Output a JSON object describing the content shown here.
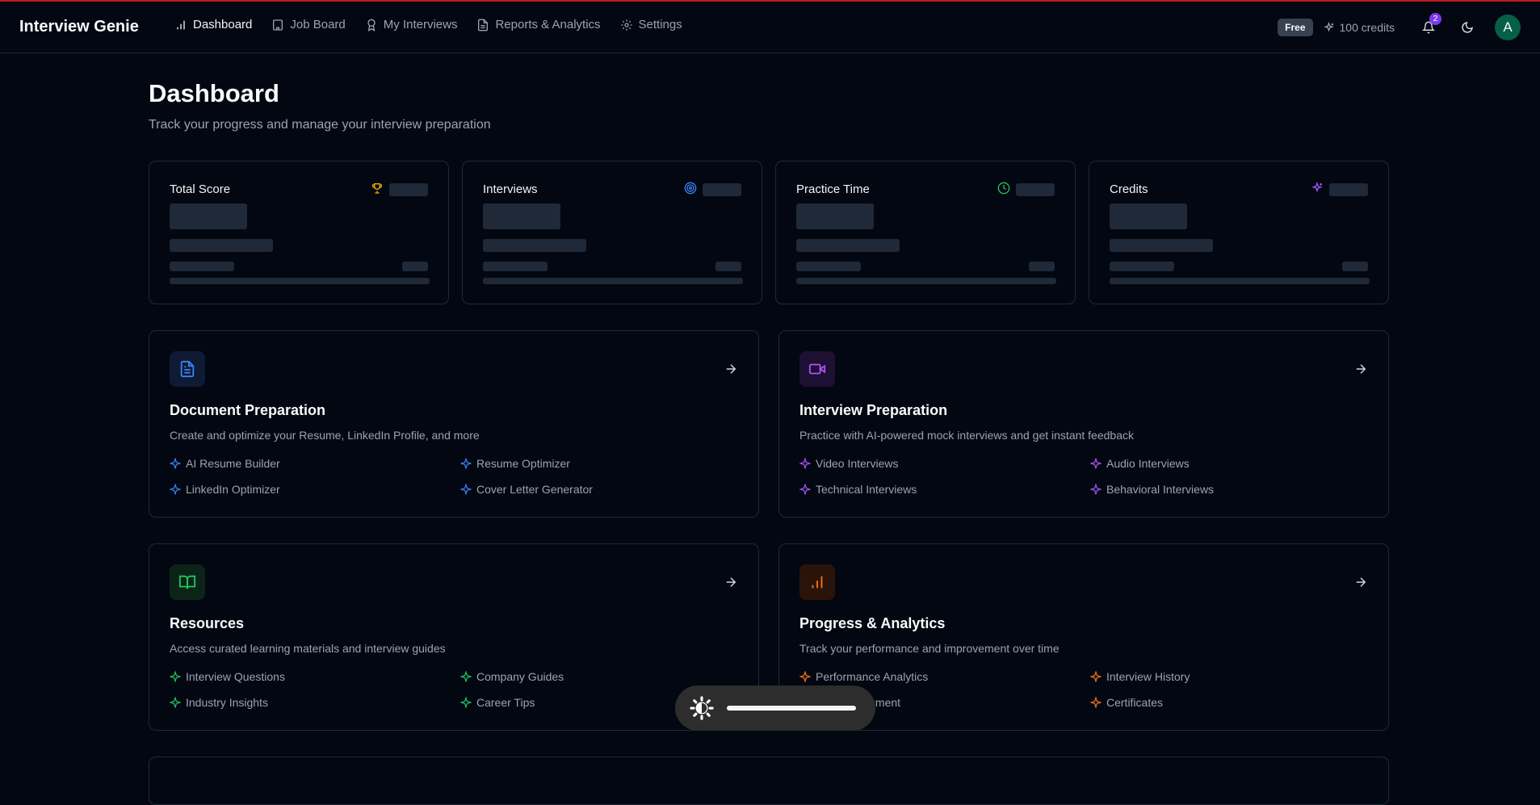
{
  "app": {
    "title": "Interview Genie"
  },
  "nav": [
    {
      "label": "Dashboard",
      "icon": "bar-chart-icon",
      "active": true
    },
    {
      "label": "Job Board",
      "icon": "building-icon"
    },
    {
      "label": "My Interviews",
      "icon": "award-icon"
    },
    {
      "label": "Reports & Analytics",
      "icon": "file-text-icon"
    },
    {
      "label": "Settings",
      "icon": "gear-icon"
    }
  ],
  "account": {
    "plan": "Free",
    "credits": "100 credits",
    "notifications": "2",
    "avatar": "A"
  },
  "page": {
    "title": "Dashboard",
    "subtitle": "Track your progress and manage your interview preparation"
  },
  "stats": [
    {
      "label": "Total Score",
      "icon": "trophy-icon",
      "color": "#eab308"
    },
    {
      "label": "Interviews",
      "icon": "target-icon",
      "color": "#3b82f6"
    },
    {
      "label": "Practice Time",
      "icon": "clock-icon",
      "color": "#22c55e"
    },
    {
      "label": "Credits",
      "icon": "sparkles-icon",
      "color": "#a855f7"
    }
  ],
  "modules": [
    {
      "title": "Document Preparation",
      "description": "Create and optimize your Resume, LinkedIn Profile, and more",
      "icon": "document-icon",
      "color": "#3b82f6",
      "features": [
        "AI Resume Builder",
        "Resume Optimizer",
        "LinkedIn Optimizer",
        "Cover Letter Generator"
      ]
    },
    {
      "title": "Interview Preparation",
      "description": "Practice with AI-powered mock interviews and get instant feedback",
      "icon": "video-icon",
      "color": "#a855f7",
      "features": [
        "Video Interviews",
        "Audio Interviews",
        "Technical Interviews",
        "Behavioral Interviews"
      ]
    },
    {
      "title": "Resources",
      "description": "Access curated learning materials and interview guides",
      "icon": "book-icon",
      "color": "#22c55e",
      "features": [
        "Interview Questions",
        "Company Guides",
        "Industry Insights",
        "Career Tips"
      ]
    },
    {
      "title": "Progress & Analytics",
      "description": "Track your performance and improvement over time",
      "icon": "bar-chart-icon",
      "color": "#f97316",
      "features": [
        "Performance Analytics",
        "Interview History",
        "Skill Assessment",
        "Certificates"
      ]
    }
  ]
}
